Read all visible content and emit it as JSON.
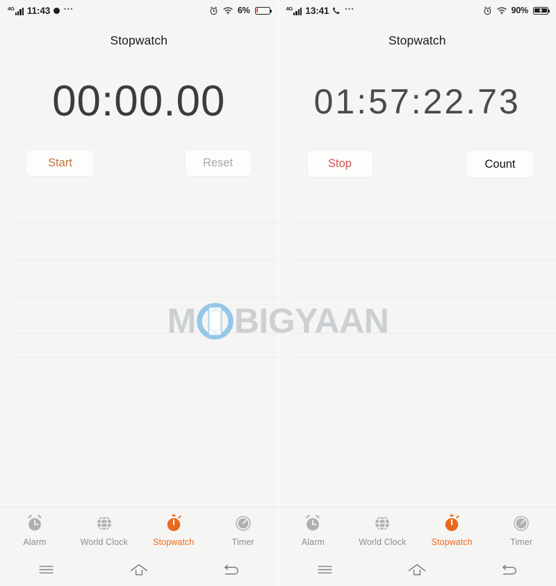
{
  "app": {
    "title": "Stopwatch"
  },
  "colors": {
    "accent_orange": "#e9691f",
    "start_text": "#c4703e",
    "stop_text": "#d04f4f",
    "count_text": "#111111",
    "reset_text": "#a8a8a8",
    "tab_inactive": "#8d8d8d",
    "background": "#f5f5f4",
    "button_bg": "#fdfdfc",
    "battery_low": "#e03b2f",
    "battery_charging": "#1d1d1d",
    "watermark_text": "#c9cdd0",
    "watermark_logo": "#8dc5e8"
  },
  "panels": [
    {
      "id": "panel-idle",
      "statusbar": {
        "network_label": "4G",
        "time": "11:43",
        "icons_left": [
          "signal-bars-icon",
          "notification-dot-icon",
          "more-ellipsis-icon"
        ],
        "icons_right": [
          "alarm-icon",
          "wifi-icon"
        ],
        "battery_percent": "6%",
        "battery_level": 6,
        "battery_charging": false
      },
      "title": "Stopwatch",
      "timer": "00:00.00",
      "timer_long": false,
      "buttons": {
        "primary": {
          "label": "Start",
          "state": "enabled",
          "name": "start-button"
        },
        "secondary": {
          "label": "Reset",
          "state": "disabled",
          "name": "reset-button"
        }
      },
      "lap_dividers": [
        28,
        81,
        134,
        186,
        221
      ],
      "laps": []
    },
    {
      "id": "panel-running",
      "statusbar": {
        "network_label": "4G",
        "time": "13:41",
        "icons_left": [
          "signal-bars-icon",
          "phone-call-icon",
          "more-ellipsis-icon"
        ],
        "icons_right": [
          "alarm-icon",
          "wifi-icon"
        ],
        "battery_percent": "90%",
        "battery_level": 90,
        "battery_charging": true
      },
      "title": "Stopwatch",
      "timer": "01:57:22.73",
      "timer_long": true,
      "buttons": {
        "primary": {
          "label": "Stop",
          "state": "enabled",
          "name": "stop-button"
        },
        "secondary": {
          "label": "Count",
          "state": "enabled",
          "name": "count-button"
        }
      },
      "lap_dividers": [
        28,
        81,
        134,
        186,
        221
      ],
      "laps": []
    }
  ],
  "tabs": [
    {
      "label": "Alarm",
      "icon": "alarm-clock-icon",
      "active": false,
      "name": "tab-alarm"
    },
    {
      "label": "World Clock",
      "icon": "globe-icon",
      "active": false,
      "name": "tab-world-clock"
    },
    {
      "label": "Stopwatch",
      "icon": "stopwatch-icon",
      "active": true,
      "name": "tab-stopwatch"
    },
    {
      "label": "Timer",
      "icon": "timer-icon",
      "active": false,
      "name": "tab-timer"
    }
  ],
  "navbar": [
    {
      "icon": "menu-icon",
      "name": "nav-menu-button"
    },
    {
      "icon": "home-icon",
      "name": "nav-home-button"
    },
    {
      "icon": "back-icon",
      "name": "nav-back-button"
    }
  ],
  "watermark": {
    "text_before": "M",
    "logo": "mobigyaan-phone-logo",
    "text_after": "BIGYAAN",
    "full_text": "MOBIGYAAN"
  }
}
